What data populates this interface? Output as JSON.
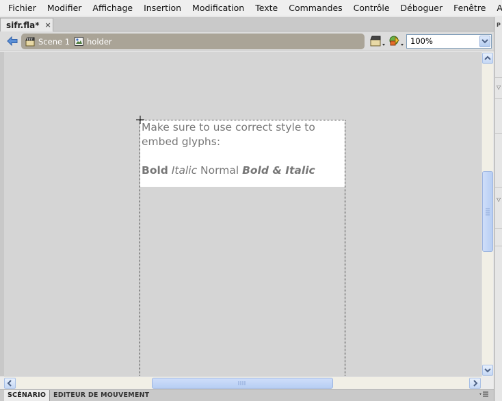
{
  "menu": [
    "Fichier",
    "Modifier",
    "Affichage",
    "Insertion",
    "Modification",
    "Texte",
    "Commandes",
    "Contrôle",
    "Déboguer",
    "Fenêtre",
    "Aide"
  ],
  "document_tab": {
    "label": "sifr.fla*",
    "close": "×"
  },
  "breadcrumb": {
    "scene": "Scene 1",
    "symbol": "holder"
  },
  "zoom": {
    "value": "100%"
  },
  "stage_text": {
    "line1": "Make sure to use correct style to",
    "line2": "embed glyphs:",
    "bold": "Bold",
    "italic": "Italic",
    "normal": "Normal",
    "bold_italic": "Bold & Italic"
  },
  "bottom_tabs": {
    "scenario": "SCÉNARIO",
    "motion_editor": "EDITEUR DE MOUVEMENT"
  },
  "right_panel": {
    "letter": "P"
  },
  "icons": [
    "back-arrow-icon",
    "scene-icon",
    "symbol-icon",
    "edit-scene-icon",
    "edit-symbol-icon",
    "chevron-down-icon",
    "scroll-arrow-icons",
    "panel-menu-icon"
  ],
  "colors": {
    "stage": "#d5d5d5",
    "breadcrumb_bar": "#aaa497",
    "text": "#777777",
    "scrollbar_accent": "#b7cef3"
  },
  "scrollbars": {
    "vertical_position": 0.45,
    "horizontal_position": 0.33
  }
}
